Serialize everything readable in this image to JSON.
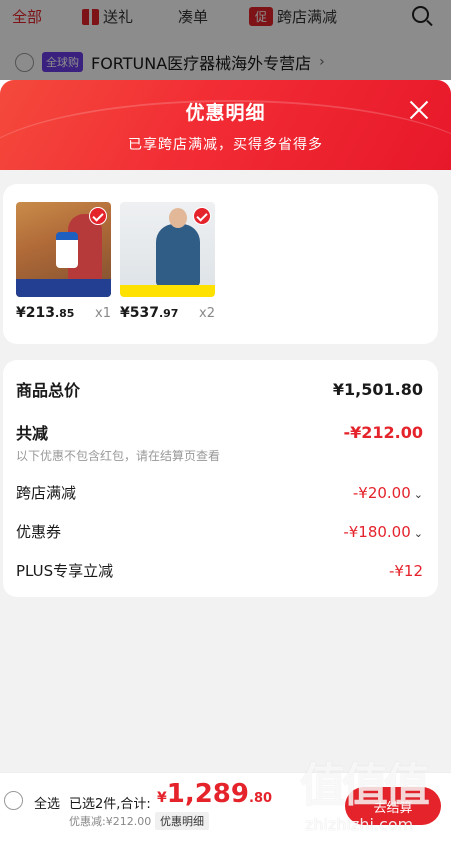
{
  "background": {
    "tabs": [
      {
        "label": "全部"
      },
      {
        "label": "送礼"
      },
      {
        "label": "凑单"
      },
      {
        "label": "跨店满减",
        "badge": "促"
      }
    ],
    "store": {
      "badge": "全球购",
      "name": "FORTUNA医疗器械海外专营店",
      "chevron": "›"
    }
  },
  "sheet": {
    "title": "优惠明细",
    "subtitle": "已享跨店满减，买得多省得多"
  },
  "products": [
    {
      "price_main": "¥213",
      "price_dec": ".85",
      "qty": "x1"
    },
    {
      "price_main": "¥537",
      "price_dec": ".97",
      "qty": "x2"
    }
  ],
  "details": {
    "total": {
      "label": "商品总价",
      "value": "¥1,501.80"
    },
    "discount": {
      "label": "共减",
      "value": "-¥212.00",
      "note": "以下优惠不包含红包，请在结算页查看"
    },
    "cross_store": {
      "label": "跨店满减",
      "value": "-¥20.00",
      "arrow": "⌄"
    },
    "coupon": {
      "label": "优惠券",
      "value": "-¥180.00",
      "arrow": "⌄"
    },
    "plus": {
      "label": "PLUS专享立减",
      "value": "-¥12"
    }
  },
  "bottom": {
    "select_all": "全选",
    "selected": "已选2件,合计:",
    "currency": "¥",
    "total_main": "1,289",
    "total_dec": ".80",
    "saved": "优惠减:¥212.00",
    "detail_btn": "优惠明细",
    "checkout": "去结算"
  },
  "watermark": {
    "logo": "值值值",
    "url": "zhizhizhi.com"
  },
  "colors": {
    "accent": "#e4232b",
    "global_badge": "#6a3de8"
  }
}
